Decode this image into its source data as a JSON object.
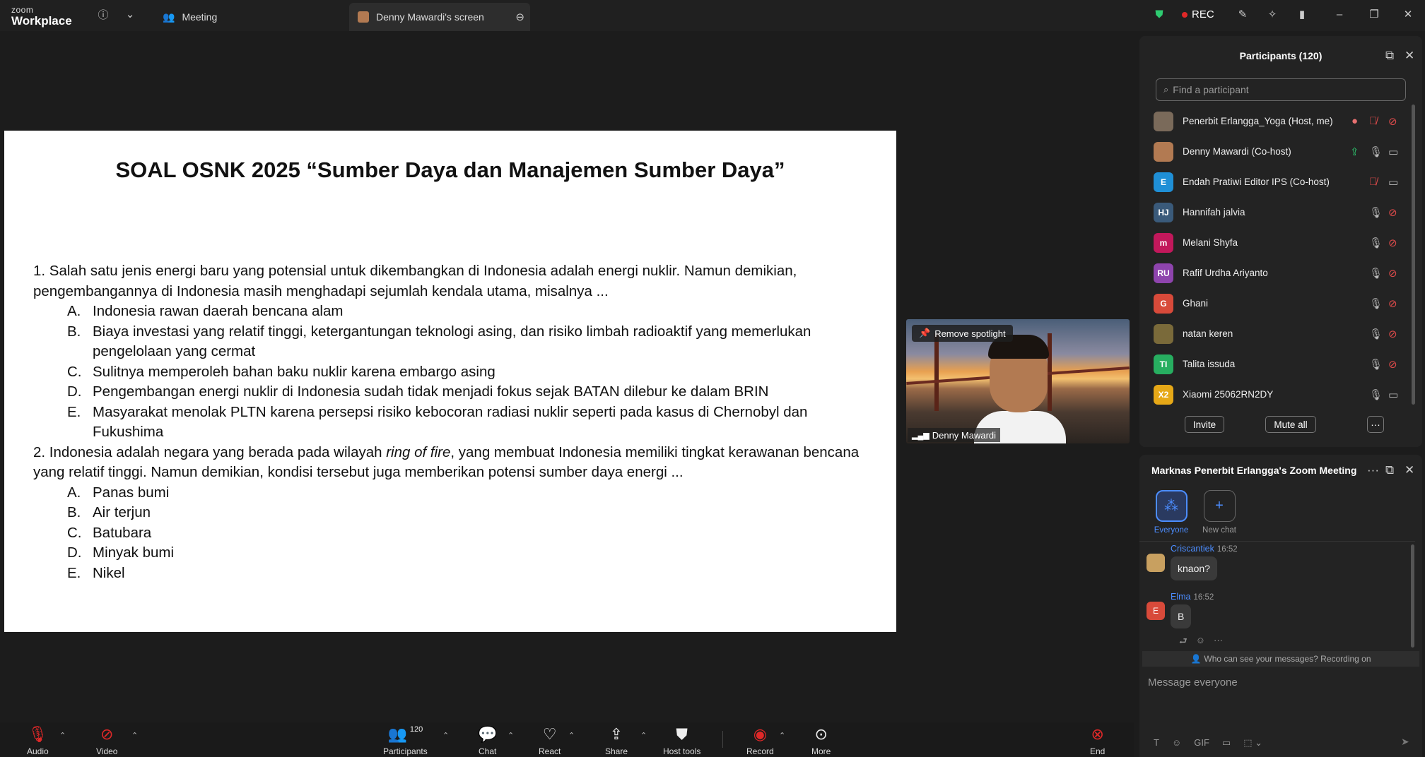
{
  "app": {
    "logo_top": "zoom",
    "logo_bottom": "Workplace"
  },
  "tabs": [
    {
      "label": "Meeting",
      "icon": "meeting-icon"
    },
    {
      "label": "Denny Mawardi's screen",
      "icon": "screen-share-avatar"
    }
  ],
  "topbar": {
    "rec_label": "REC"
  },
  "slide": {
    "title": "SOAL OSNK 2025 “Sumber Daya dan Manajemen Sumber Daya”",
    "q1": "1. Salah satu jenis energi baru yang potensial untuk dikembangkan di Indonesia adalah energi nuklir. Namun demikian, pengembangannya di Indonesia masih menghadapi sejumlah kendala utama, misalnya ...",
    "q1_options": [
      {
        "letter": "A.",
        "text": "Indonesia rawan daerah bencana alam"
      },
      {
        "letter": "B.",
        "text": "Biaya investasi yang relatif tinggi, ketergantungan teknologi asing, dan risiko limbah radioaktif yang memerlukan pengelolaan yang cermat"
      },
      {
        "letter": "C.",
        "text": "Sulitnya memperoleh bahan baku nuklir karena embargo asing"
      },
      {
        "letter": "D.",
        "text": "Pengembangan energi nuklir di Indonesia sudah tidak menjadi fokus sejak BATAN dilebur ke dalam BRIN"
      },
      {
        "letter": "E.",
        "text": "Masyarakat menolak PLTN karena persepsi risiko kebocoran radiasi nuklir seperti pada kasus di Chernobyl dan Fukushima"
      }
    ],
    "q2_pre": "2. Indonesia adalah negara yang berada pada wilayah ",
    "q2_italic": "ring of fire",
    "q2_post": ", yang membuat Indonesia memiliki tingkat kerawanan bencana yang relatif tinggi. Namun demikian, kondisi tersebut juga memberikan potensi sumber daya energi ...",
    "q2_options": [
      {
        "letter": "A.",
        "text": "Panas bumi"
      },
      {
        "letter": "B.",
        "text": "Air terjun"
      },
      {
        "letter": "C.",
        "text": "Batubara"
      },
      {
        "letter": "D.",
        "text": "Minyak bumi"
      },
      {
        "letter": "E.",
        "text": "Nikel"
      }
    ]
  },
  "video": {
    "spotlight_label": "Remove spotlight",
    "name": "Denny Mawardi"
  },
  "participants": {
    "title": "Participants (120)",
    "search_placeholder": "Find a participant",
    "list": [
      {
        "name": "Penerbit Erlangga_Yoga (Host, me)",
        "avatar": "",
        "avatar_color": "#7a6a5a",
        "mic": "muted",
        "video": "off"
      },
      {
        "name": "Denny Mawardi (Co-host)",
        "avatar": "",
        "avatar_color": "#b27a52",
        "mic": "on",
        "video": "on"
      },
      {
        "name": "Endah Pratiwi Editor IPS (Co-host)",
        "avatar": "E",
        "avatar_color": "#1f8fd6",
        "mic": "muted",
        "video": "on"
      },
      {
        "name": "Hannifah jalvia",
        "avatar": "HJ",
        "avatar_color": "#3a5a7a",
        "mic": "on",
        "video": "off"
      },
      {
        "name": "Melani Shyfa",
        "avatar": "m",
        "avatar_color": "#c2185b",
        "mic": "on",
        "video": "off"
      },
      {
        "name": "Rafif Urdha Ariyanto",
        "avatar": "RU",
        "avatar_color": "#8e44ad",
        "mic": "on",
        "video": "off"
      },
      {
        "name": "Ghani",
        "avatar": "G",
        "avatar_color": "#d84a3a",
        "mic": "on",
        "video": "off"
      },
      {
        "name": "natan keren",
        "avatar": "",
        "avatar_color": "#7a6a3a",
        "mic": "on",
        "video": "off"
      },
      {
        "name": "Talita issuda",
        "avatar": "TI",
        "avatar_color": "#27ae60",
        "mic": "on",
        "video": "off"
      },
      {
        "name": "Xiaomi 25062RN2DY",
        "avatar": "X2",
        "avatar_color": "#e6a817",
        "mic": "on",
        "video": "on"
      }
    ],
    "invite_label": "Invite",
    "mute_all_label": "Mute all",
    "more_label": "···"
  },
  "chat": {
    "title": "Marknas Penerbit Erlangga's Zoom Meeting",
    "tabs": [
      {
        "label": "Everyone"
      },
      {
        "label": "New chat"
      }
    ],
    "messages": [
      {
        "sender": "Criscantiek",
        "time": "16:52",
        "text": "knaon?",
        "avatar": "",
        "avatar_color": "#c8a060"
      },
      {
        "sender": "Elma",
        "time": "16:52",
        "text": "B",
        "avatar": "E",
        "avatar_color": "#d84a3a"
      }
    ],
    "visibility_note": "Who can see your messages? Recording on",
    "input_placeholder": "Message everyone",
    "gif_label": "GIF"
  },
  "toolbar": {
    "audio": "Audio",
    "video": "Video",
    "participants": "Participants",
    "participants_count": "120",
    "chat": "Chat",
    "react": "React",
    "share": "Share",
    "host_tools": "Host tools",
    "record": "Record",
    "more": "More",
    "end": "End"
  },
  "colors": {
    "accent": "#4c8dff",
    "record_red": "#e02828",
    "panel_bg": "#232323"
  }
}
